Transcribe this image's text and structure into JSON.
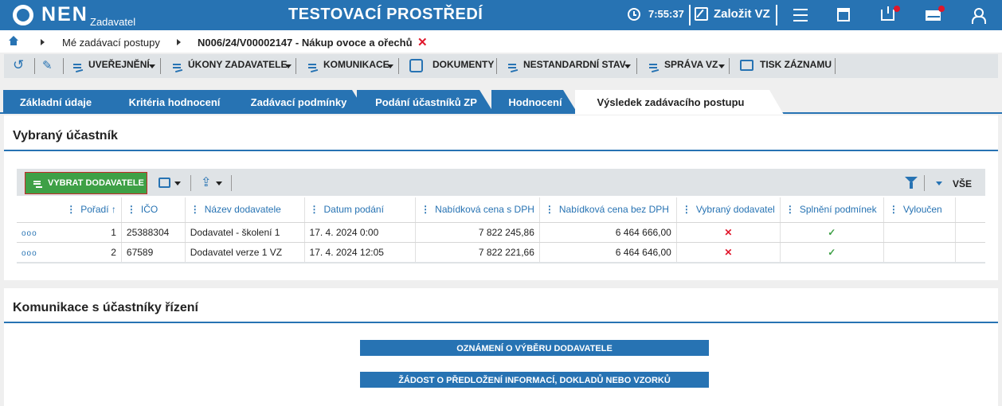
{
  "header": {
    "logo": "NEN",
    "logo_sub": "Zadavatel",
    "environment": "TESTOVACÍ PROSTŘEDÍ",
    "clock": "7:55:37",
    "create_label": "Založit VZ"
  },
  "breadcrumb": {
    "item1": "Mé zadávací postupy",
    "item2": "N006/24/V00002147 - Nákup ovoce a ořechů"
  },
  "toolbar": {
    "uverejneni": "UVEŘEJNĚNÍ",
    "ukony": "ÚKONY ZADAVATELE",
    "komunikace": "KOMUNIKACE",
    "dokumenty": "DOKUMENTY",
    "nestandardni": "NESTANDARDNÍ STAV",
    "sprava": "SPRÁVA VZ",
    "tisk": "TISK ZÁZNAMU"
  },
  "tabs": [
    "Základní údaje",
    "Kritéria hodnocení",
    "Zadávací podmínky",
    "Podání účastníků ZP",
    "Hodnocení",
    "Výsledek zadávacího postupu"
  ],
  "section1": {
    "title": "Vybraný účastník",
    "select_button": "VYBRAT DODAVATELE",
    "all_label": "VŠE",
    "columns": [
      "Pořadí ↑",
      "IČO",
      "Název dodavatele",
      "Datum podání",
      "Nabídková cena s DPH",
      "Nabídková cena bez DPH",
      "Vybraný dodavatel",
      "Splnění podmínek",
      "Vyloučen"
    ],
    "rows": [
      {
        "more": "ooo",
        "order": "1",
        "ico": "25388304",
        "name": "Dodavatel - školení 1",
        "date": "17. 4. 2024 0:00",
        "price_vat": "7 822 245,86",
        "price_novat": "6 464 666,00",
        "selected": "✕",
        "conditions": "✓",
        "excluded": ""
      },
      {
        "more": "ooo",
        "order": "2",
        "ico": "67589",
        "name": "Dodavatel verze 1 VZ",
        "date": "17. 4. 2024 12:05",
        "price_vat": "7 822 221,66",
        "price_novat": "6 464 646,00",
        "selected": "✕",
        "conditions": "✓",
        "excluded": ""
      }
    ]
  },
  "section2": {
    "title": "Komunikace s účastníky řízení",
    "button1": "OZNÁMENÍ O VÝBĚRU DODAVATELE",
    "button2": "ŽÁDOST O PŘEDLOŽENÍ INFORMACÍ, DOKLADŮ NEBO VZORKŮ"
  },
  "colors": {
    "brand": "#2773b3",
    "green": "#3ea046",
    "red": "#e0172b"
  }
}
